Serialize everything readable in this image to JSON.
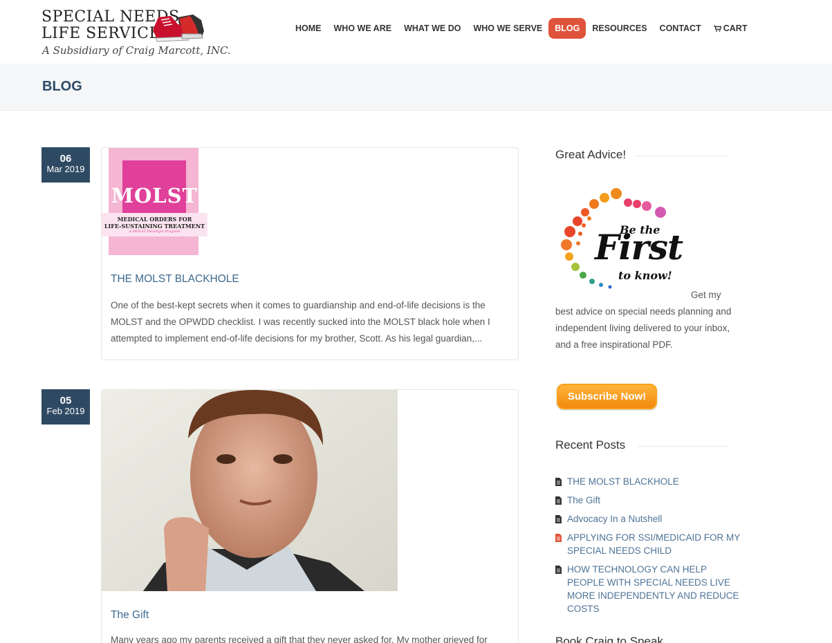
{
  "logo": {
    "line1": "SPECIAL NEEDS",
    "line2": "LIFE SERVICES",
    "tagline": "A Subsidiary of Craig Marcott, INC."
  },
  "nav": {
    "items": [
      {
        "label": "HOME",
        "active": false
      },
      {
        "label": "WHO WE ARE",
        "active": false
      },
      {
        "label": "WHAT WE DO",
        "active": false
      },
      {
        "label": "WHO WE SERVE",
        "active": false
      },
      {
        "label": "BLOG",
        "active": true
      },
      {
        "label": "RESOURCES",
        "active": false
      },
      {
        "label": "CONTACT",
        "active": false
      },
      {
        "label": "CART",
        "active": false,
        "icon": "cart-icon"
      }
    ]
  },
  "page": {
    "title": "BLOG"
  },
  "posts": [
    {
      "day": "06",
      "month_year": "Mar 2019",
      "image_text": {
        "word": "MOLST",
        "line1": "MEDICAL ORDERS FOR",
        "line2": "LIFE-SUSTAINING TREATMENT",
        "line3": "A MOLST Paradigm Program"
      },
      "title": "THE MOLST BLACKHOLE",
      "excerpt": "One of the best-kept secrets when it comes to guardianship and end-of-life decisions is the MOLST and the OPWDD checklist.  I was recently sucked into the MOLST black hole when I attempted to implement end-of-life decisions for my brother, Scott.  As his legal guardian,..."
    },
    {
      "day": "05",
      "month_year": "Feb 2019",
      "title": "The Gift",
      "excerpt": "Many years ago my parents received a gift that they never asked for. My mother grieved for"
    }
  ],
  "sidebar": {
    "great_advice": {
      "title": "Great Advice!",
      "image_text": {
        "line1": "Be the",
        "line2": "First",
        "line3": "to know!"
      },
      "text_first": "Get my",
      "text_rest": "best advice on special needs planning and independent living delivered to your inbox, and a free inspirational PDF.",
      "button": "Subscribe Now!"
    },
    "recent_posts": {
      "title": "Recent Posts",
      "items": [
        "THE MOLST BLACKHOLE",
        "The Gift",
        "Advocacy In a Nutshell",
        "APPLYING FOR SSI/MEDICAID FOR MY SPECIAL NEEDS CHILD",
        "HOW TECHNOLOGY CAN HELP PEOPLE WITH SPECIAL NEEDS LIVE MORE INDEPENDENTLY AND REDUCE COSTS"
      ]
    },
    "next_widget_title": "Book Craig to Speak"
  },
  "colors": {
    "nav_active": "#e0533b",
    "date_badge": "#2e4a63",
    "title": "#2d4a66",
    "link": "#3e6a8e",
    "molst_pink": "#e0409a",
    "subscribe_orange": "#f5981c"
  }
}
